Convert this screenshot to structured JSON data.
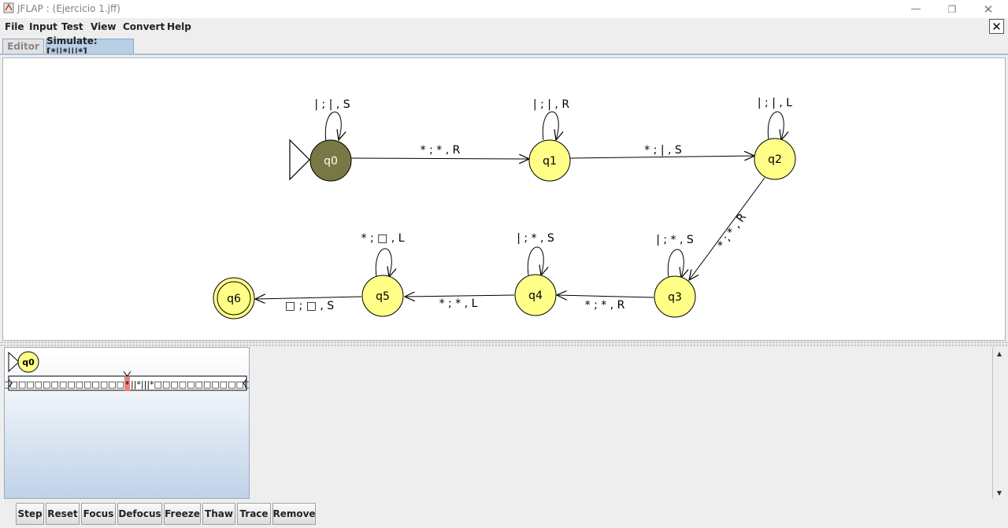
{
  "window": {
    "title": "JFLAP : (Ejercicio 1.jff)",
    "minimize": "—",
    "maximize": "❐",
    "close": "✕",
    "doc_close": "✕"
  },
  "menu": [
    "File",
    "Input",
    "Test",
    "View",
    "Convert",
    "Help"
  ],
  "tabs": [
    {
      "label": "Editor",
      "active": false
    },
    {
      "label": "Simulate: [*||*|||*]",
      "active": true
    }
  ],
  "automaton": {
    "initial_state": "q0",
    "final_state": "q6",
    "current_state": "q0",
    "states": [
      "q0",
      "q1",
      "q2",
      "q3",
      "q4",
      "q5",
      "q6"
    ],
    "transitions": [
      {
        "from": "q0",
        "to": "q0",
        "label": "| ; | , S"
      },
      {
        "from": "q0",
        "to": "q1",
        "label": "* ; * , R"
      },
      {
        "from": "q1",
        "to": "q1",
        "label": "| ; | , R"
      },
      {
        "from": "q1",
        "to": "q2",
        "label": "* ; | , S"
      },
      {
        "from": "q2",
        "to": "q2",
        "label": "| ; | , L"
      },
      {
        "from": "q2",
        "to": "q3",
        "label": "* ; * , R"
      },
      {
        "from": "q3",
        "to": "q3",
        "label": "| ; * , S"
      },
      {
        "from": "q3",
        "to": "q4",
        "label": "* ; * , R"
      },
      {
        "from": "q4",
        "to": "q4",
        "label": "| ; * , S"
      },
      {
        "from": "q4",
        "to": "q5",
        "label": "* ; * , L"
      },
      {
        "from": "q5",
        "to": "q5",
        "label": "* ; □ , L"
      },
      {
        "from": "q5",
        "to": "q6",
        "label": "□ ; □ , S"
      }
    ],
    "colors": {
      "state_fill": "#ffff88",
      "current_fill": "#787844",
      "edge": "#000000"
    }
  },
  "configuration": {
    "state": "q0",
    "tape_left": "□□□□□□□□□□□□□□□□",
    "tape_head": "*",
    "tape_right": "||*|||*□□□□□□□□□□□□",
    "head_color": "#f08080"
  },
  "buttons": [
    "Step",
    "Reset",
    "Focus",
    "Defocus",
    "Freeze",
    "Thaw",
    "Trace",
    "Remove"
  ]
}
